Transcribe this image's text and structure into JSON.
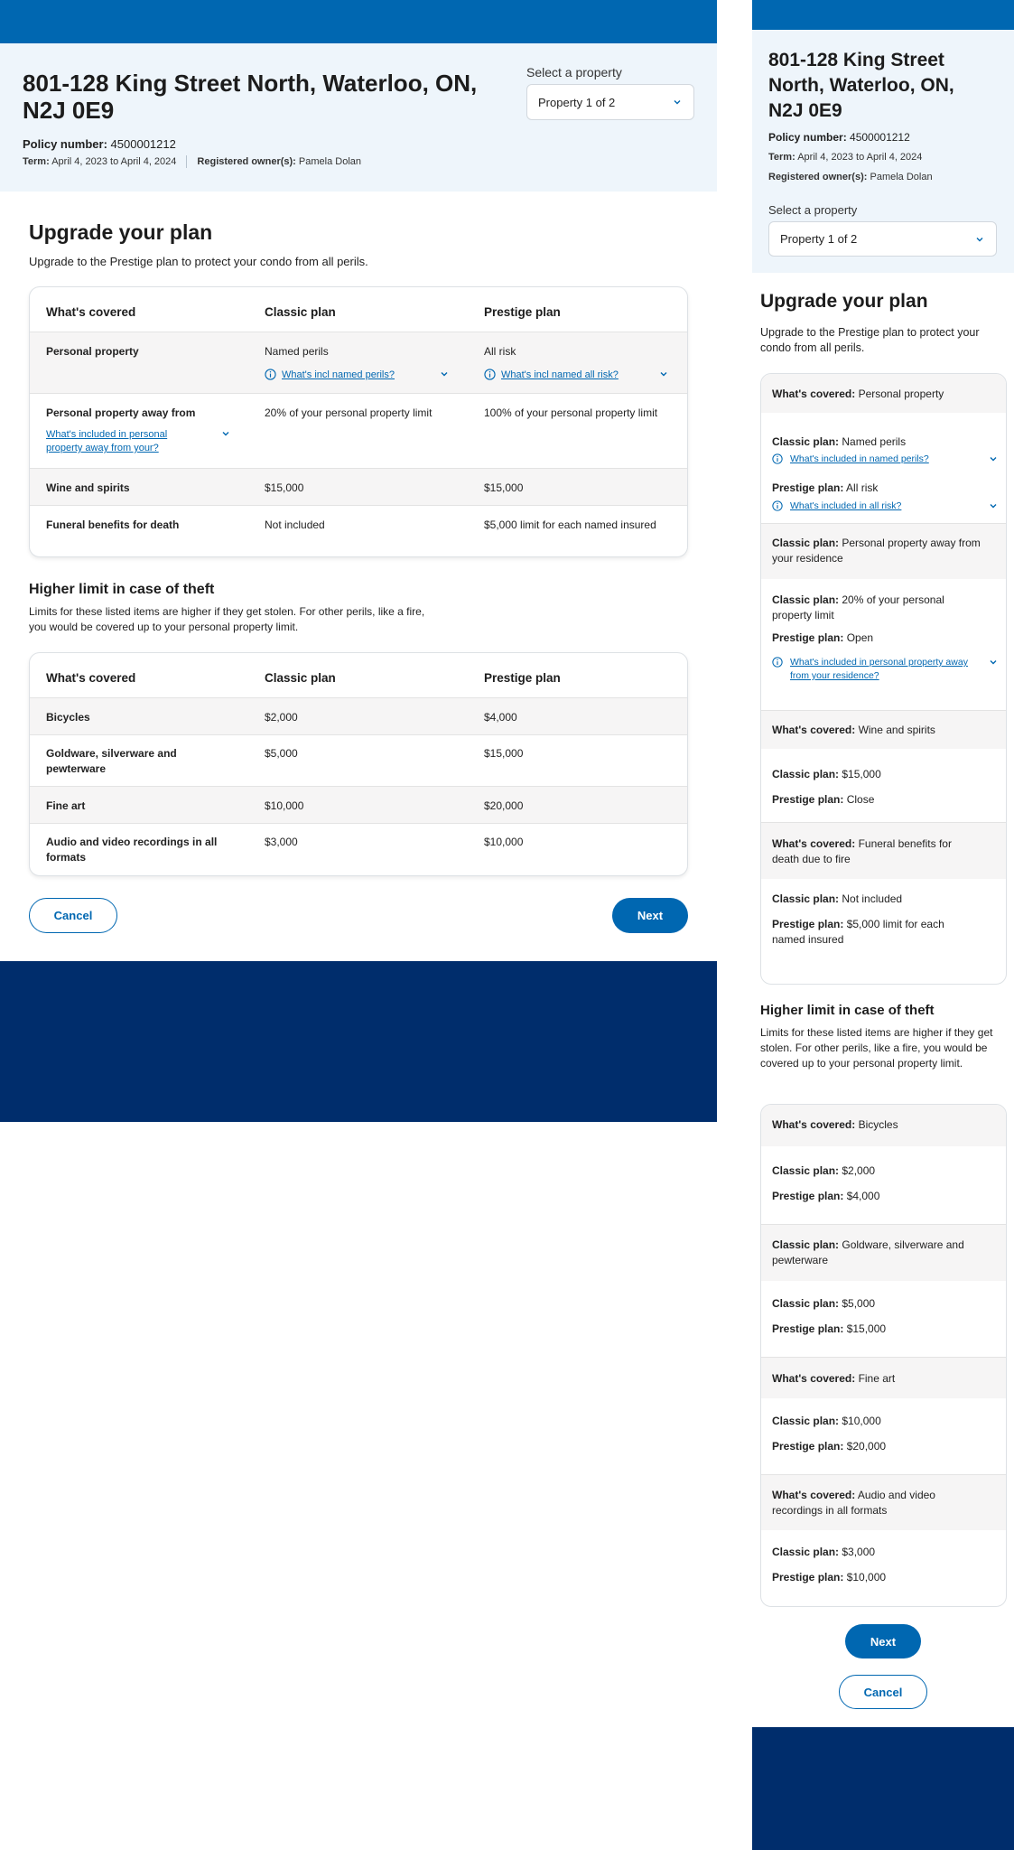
{
  "colors": {
    "brand_blue": "#0067b1",
    "navy_footer": "#002d6c",
    "header_bg": "#eef5fb",
    "row_shade": "#f6f5f5"
  },
  "property": {
    "address": "801-128 King Street North, Waterloo, ON, N2J 0E9",
    "policy_label": "Policy number:",
    "policy_number": "4500001212",
    "term_label": "Term:",
    "term_value": "April 4, 2023 to April 4, 2024",
    "owner_label": "Registered owner(s):",
    "owner_value": "Pamela Dolan",
    "select_label": "Select a property",
    "select_value": "Property 1 of 2"
  },
  "upgrade": {
    "title": "Upgrade your plan",
    "subtitle": "Upgrade to the Prestige plan to protect your condo from all perils."
  },
  "coverage_table": {
    "headers": [
      "What's covered",
      "Classic plan",
      "Prestige plan"
    ],
    "rows": [
      {
        "name": "Personal property",
        "classic": "Named perils",
        "prestige": "All risk",
        "classic_link": "What's incl named perils?",
        "prestige_link": "What's incl named all risk?"
      },
      {
        "name": "Personal property away from",
        "name_link": "What's included in personal property away from your?",
        "classic": "20% of your personal property limit",
        "prestige": "100% of your personal property limit"
      },
      {
        "name": "Wine and spirits",
        "classic": "$15,000",
        "prestige": "$15,000"
      },
      {
        "name": "Funeral benefits for death",
        "classic": "Not included",
        "prestige": "$5,000 limit for each named insured"
      }
    ]
  },
  "theft": {
    "title": "Higher limit in case of theft",
    "subtitle": "Limits for these listed items are higher if they get stolen. For other perils, like a fire, you would be covered up to your personal property limit.",
    "headers": [
      "What's covered",
      "Classic plan",
      "Prestige plan"
    ],
    "rows": [
      {
        "name": "Bicycles",
        "classic": "$2,000",
        "prestige": "$4,000"
      },
      {
        "name": "Goldware, silverware and pewterware",
        "classic": "$5,000",
        "prestige": "$15,000"
      },
      {
        "name": "Fine art",
        "classic": "$10,000",
        "prestige": "$20,000"
      },
      {
        "name": "Audio and video recordings in all formats",
        "classic": "$3,000",
        "prestige": "$10,000"
      }
    ]
  },
  "buttons": {
    "cancel": "Cancel",
    "next": "Next"
  },
  "mobile": {
    "whats_covered_label": "What's covered:",
    "classic_label": "Classic plan:",
    "prestige_label": "Prestige plan:",
    "coverage": [
      {
        "head_label": "What's covered:",
        "head_value": "Personal property",
        "classic": "Named perils",
        "classic_link": "What's included in named perils?",
        "prestige": "All risk",
        "prestige_link": "What's included in all risk?"
      },
      {
        "head_label": "Classic plan:",
        "head_value": "Personal property away from your residence",
        "classic": "20% of your personal property limit",
        "prestige": "Open",
        "prestige_link": "What's included in personal property away from your residence?"
      },
      {
        "head_label": "What's covered:",
        "head_value": "Wine and spirits",
        "classic": "$15,000",
        "prestige": "Close"
      },
      {
        "head_label": "What's covered:",
        "head_value": "Funeral benefits for death due to fire",
        "classic": "Not included",
        "prestige": "$5,000 limit for each named insured"
      }
    ],
    "theft": [
      {
        "head_value": "Bicycles",
        "classic": "$2,000",
        "prestige": "$4,000"
      },
      {
        "head_value": "Goldware, silverware and pewterware",
        "classic": "$5,000",
        "prestige": "$15,000"
      },
      {
        "head_value": "Fine art",
        "classic": "$10,000",
        "prestige": "$20,000"
      },
      {
        "head_value": "Audio and video recordings in all formats",
        "classic": "$3,000",
        "prestige": "$10,000"
      }
    ]
  }
}
